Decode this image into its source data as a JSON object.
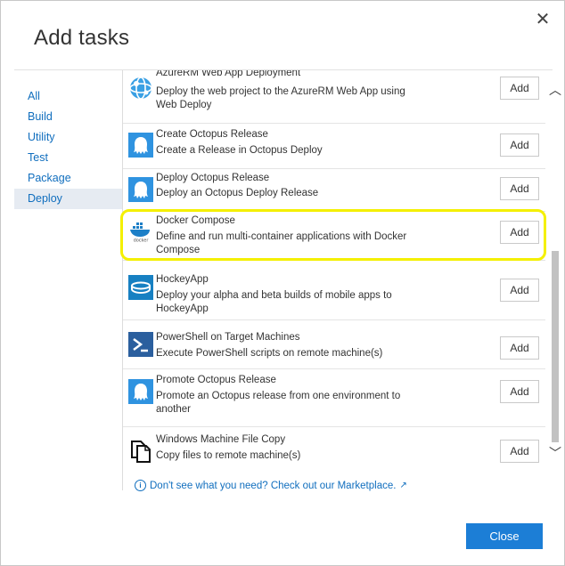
{
  "dialog": {
    "title": "Add tasks",
    "close_glyph": "✕"
  },
  "sidebar": {
    "items": [
      {
        "label": "All"
      },
      {
        "label": "Build"
      },
      {
        "label": "Utility"
      },
      {
        "label": "Test"
      },
      {
        "label": "Package"
      },
      {
        "label": "Deploy",
        "selected": true
      }
    ]
  },
  "tasks": [
    {
      "name": "AzureRM Web App Deployment",
      "desc": "Deploy the web project to the AzureRM Web App using Web Deploy",
      "icon": "azure-web-app-icon",
      "add_label": "Add"
    },
    {
      "name": "Create Octopus Release",
      "desc": "Create a Release in Octopus Deploy",
      "icon": "octopus-icon",
      "add_label": "Add"
    },
    {
      "name": "Deploy Octopus Release",
      "desc": "Deploy an Octopus Deploy Release",
      "icon": "octopus-icon",
      "add_label": "Add"
    },
    {
      "name": "Docker Compose",
      "desc": "Define and run multi-container applications with Docker Compose",
      "icon": "docker-icon",
      "icon_text": "docker",
      "add_label": "Add"
    },
    {
      "name": "HockeyApp",
      "desc": "Deploy your alpha and beta builds of mobile apps to HockeyApp",
      "icon": "hockeyapp-icon",
      "add_label": "Add"
    },
    {
      "name": "PowerShell on Target Machines",
      "desc": "Execute PowerShell scripts on remote machine(s)",
      "icon": "powershell-icon",
      "add_label": "Add"
    },
    {
      "name": "Promote Octopus Release",
      "desc": "Promote an Octopus release from one environment to another",
      "icon": "octopus-icon",
      "add_label": "Add"
    },
    {
      "name": "Windows Machine File Copy",
      "desc": "Copy files to remote machine(s)",
      "icon": "file-copy-icon",
      "add_label": "Add"
    }
  ],
  "scrollbar": {
    "up_glyph": "︿",
    "down_glyph": "﹀"
  },
  "marketplace": {
    "text": "Don't see what you need? Check out our Marketplace.",
    "info_glyph": "i",
    "external_glyph": "↗"
  },
  "footer": {
    "close_label": "Close"
  },
  "colors": {
    "accent": "#1c7ed6",
    "link": "#106ebe",
    "highlight": "#f4f000",
    "octopus": "#2f93e0"
  }
}
